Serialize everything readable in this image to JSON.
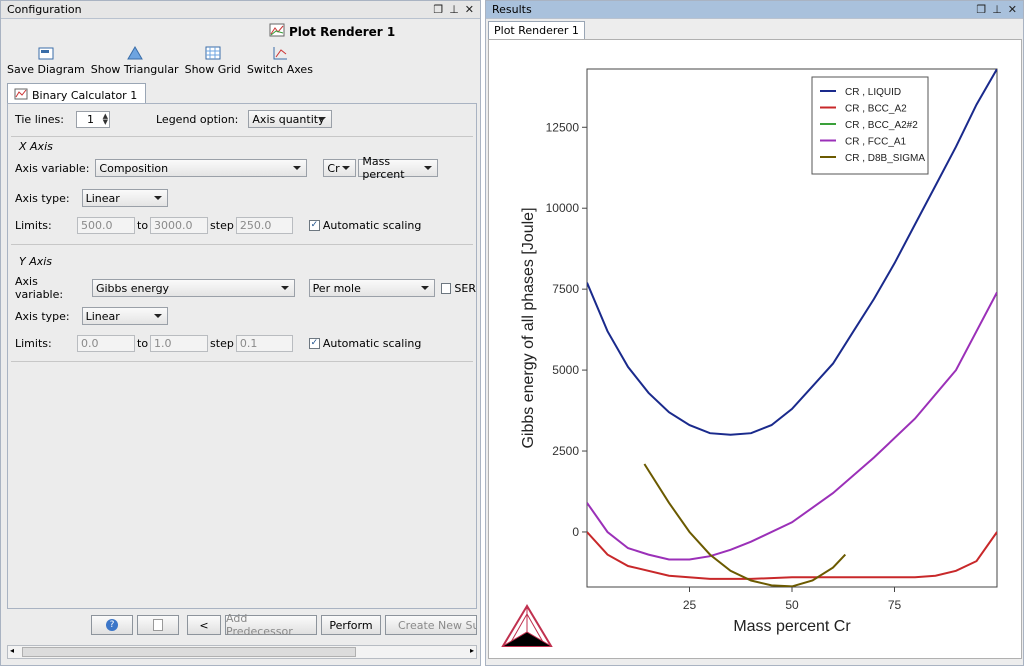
{
  "left_window": {
    "title": "Configuration",
    "plot_title": "Plot Renderer 1",
    "toolbar": [
      {
        "label": "Save Diagram",
        "icon": "save-diagram-icon"
      },
      {
        "label": "Show Triangular",
        "icon": "triangle-icon"
      },
      {
        "label": "Show Grid",
        "icon": "grid-icon"
      },
      {
        "label": "Switch Axes",
        "icon": "switch-axes-icon"
      }
    ],
    "tab": "Binary Calculator 1",
    "tie_lines_label": "Tie lines:",
    "tie_lines_value": "1",
    "legend_label": "Legend option:",
    "legend_value": "Axis quantity",
    "x_axis": {
      "section": "X Axis",
      "var_label": "Axis variable:",
      "var_value": "Composition",
      "element": "Cr",
      "unit": "Mass percent",
      "type_label": "Axis type:",
      "type_value": "Linear",
      "limits_label": "Limits:",
      "min": "500.0",
      "to": "to",
      "max": "3000.0",
      "step_label": "step",
      "step": "250.0",
      "auto_label": "Automatic scaling"
    },
    "y_axis": {
      "section": "Y Axis",
      "var_label": "Axis variable:",
      "var_value": "Gibbs energy",
      "unit": "Per mole",
      "ser_label": "SER",
      "type_label": "Axis type:",
      "type_value": "Linear",
      "limits_label": "Limits:",
      "min": "0.0",
      "to": "to",
      "max": "1.0",
      "step_label": "step",
      "step": "0.1",
      "auto_label": "Automatic scaling"
    },
    "buttons": {
      "prev": "<",
      "add_predecessor": "Add Predecessor",
      "perform": "Perform",
      "create_successor": "Create New Succe"
    }
  },
  "right_window": {
    "title": "Results",
    "tab": "Plot Renderer 1"
  },
  "chart_data": {
    "type": "line",
    "xlabel": "Mass percent Cr",
    "ylabel": "Gibbs energy of all phases [Joule]",
    "xlim": [
      0,
      100
    ],
    "ylim": [
      -1700,
      14300
    ],
    "xticks": [
      25,
      50,
      75
    ],
    "yticks": [
      0,
      2500,
      5000,
      7500,
      10000,
      12500
    ],
    "legend_position": "top-right",
    "series": [
      {
        "name": "CR , LIQUID",
        "color": "#1a2a8c",
        "x": [
          0,
          5,
          10,
          15,
          20,
          25,
          30,
          35,
          40,
          45,
          50,
          55,
          60,
          65,
          70,
          75,
          80,
          85,
          90,
          95,
          100
        ],
        "y": [
          7700,
          6200,
          5100,
          4300,
          3700,
          3300,
          3050,
          3000,
          3050,
          3300,
          3800,
          4500,
          5200,
          6200,
          7200,
          8300,
          9500,
          10700,
          11900,
          13200,
          14300
        ]
      },
      {
        "name": "CR , BCC_A2",
        "color": "#c8282a",
        "x": [
          0,
          5,
          10,
          20,
          30,
          40,
          50,
          60,
          70,
          80,
          85,
          90,
          95,
          100
        ],
        "y": [
          0,
          -700,
          -1050,
          -1350,
          -1450,
          -1450,
          -1400,
          -1400,
          -1400,
          -1400,
          -1350,
          -1200,
          -900,
          0
        ]
      },
      {
        "name": "CR , BCC_A2#2",
        "color": "#3aa03a",
        "x": [],
        "y": []
      },
      {
        "name": "CR , FCC_A1",
        "color": "#9b30b8",
        "x": [
          0,
          5,
          10,
          15,
          20,
          25,
          30,
          35,
          40,
          50,
          60,
          70,
          80,
          90,
          100
        ],
        "y": [
          900,
          0,
          -500,
          -700,
          -850,
          -850,
          -750,
          -550,
          -300,
          300,
          1200,
          2300,
          3500,
          5000,
          7400
        ]
      },
      {
        "name": "CR , D8B_SIGMA",
        "color": "#6b5a00",
        "x": [
          14,
          20,
          25,
          30,
          35,
          40,
          45,
          50,
          55,
          60,
          63
        ],
        "y": [
          2100,
          900,
          0,
          -700,
          -1200,
          -1500,
          -1650,
          -1680,
          -1500,
          -1100,
          -700
        ]
      }
    ]
  }
}
